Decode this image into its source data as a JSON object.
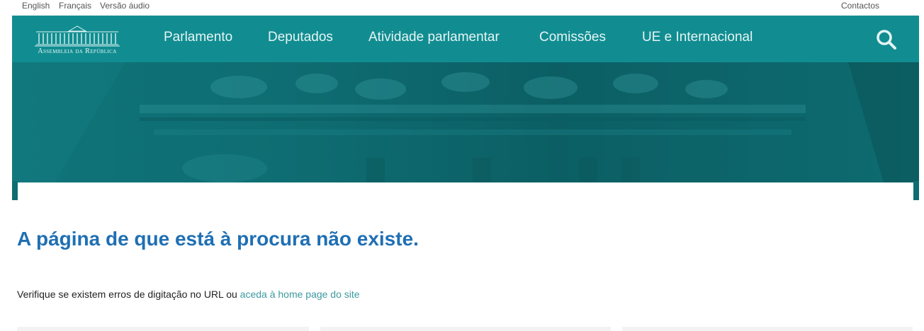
{
  "topbar": {
    "lang_en": "English",
    "lang_fr": "Français",
    "audio": "Versão áudio",
    "contacts": "Contactos"
  },
  "header": {
    "logo_text": "Assembleia da República",
    "nav": [
      "Parlamento",
      "Deputados",
      "Atividade parlamentar",
      "Comissões",
      "UE e Internacional"
    ],
    "search_icon": "search-icon",
    "bg_color": "#118d91"
  },
  "content": {
    "title": "A página de que está à procura não existe.",
    "text_prefix": "Verifique se existem erros de digitação no URL ou ",
    "home_link": "aceda à home page do site",
    "title_color": "#1f6fb3",
    "link_color": "#3c9aa0"
  }
}
